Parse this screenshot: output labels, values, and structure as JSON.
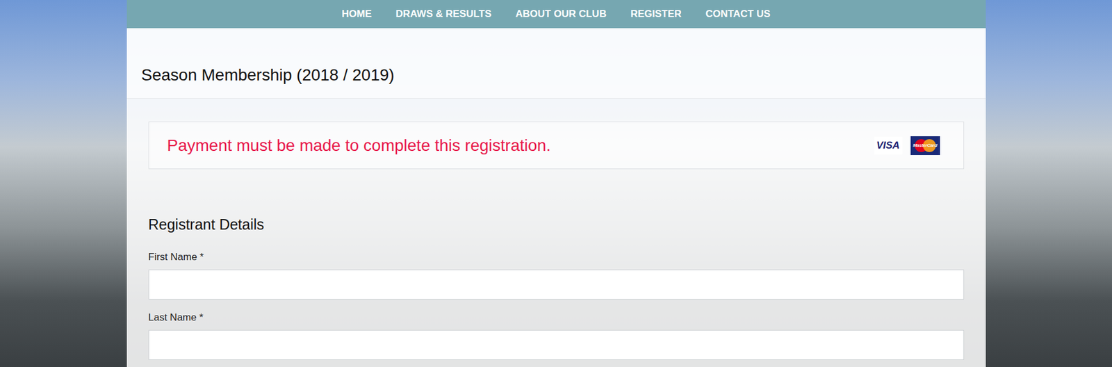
{
  "nav": {
    "items": [
      {
        "label": "HOME"
      },
      {
        "label": "DRAWS & RESULTS"
      },
      {
        "label": "ABOUT OUR CLUB"
      },
      {
        "label": "REGISTER"
      },
      {
        "label": "CONTACT US"
      }
    ]
  },
  "page": {
    "title": "Season Membership (2018 / 2019)"
  },
  "payment_notice": {
    "text": "Payment must be made to complete this registration.",
    "cards": [
      "VISA",
      "MasterCard"
    ]
  },
  "form": {
    "section_title": "Registrant Details",
    "fields": [
      {
        "label": "First Name *",
        "value": ""
      },
      {
        "label": "Last Name *",
        "value": ""
      }
    ]
  }
}
